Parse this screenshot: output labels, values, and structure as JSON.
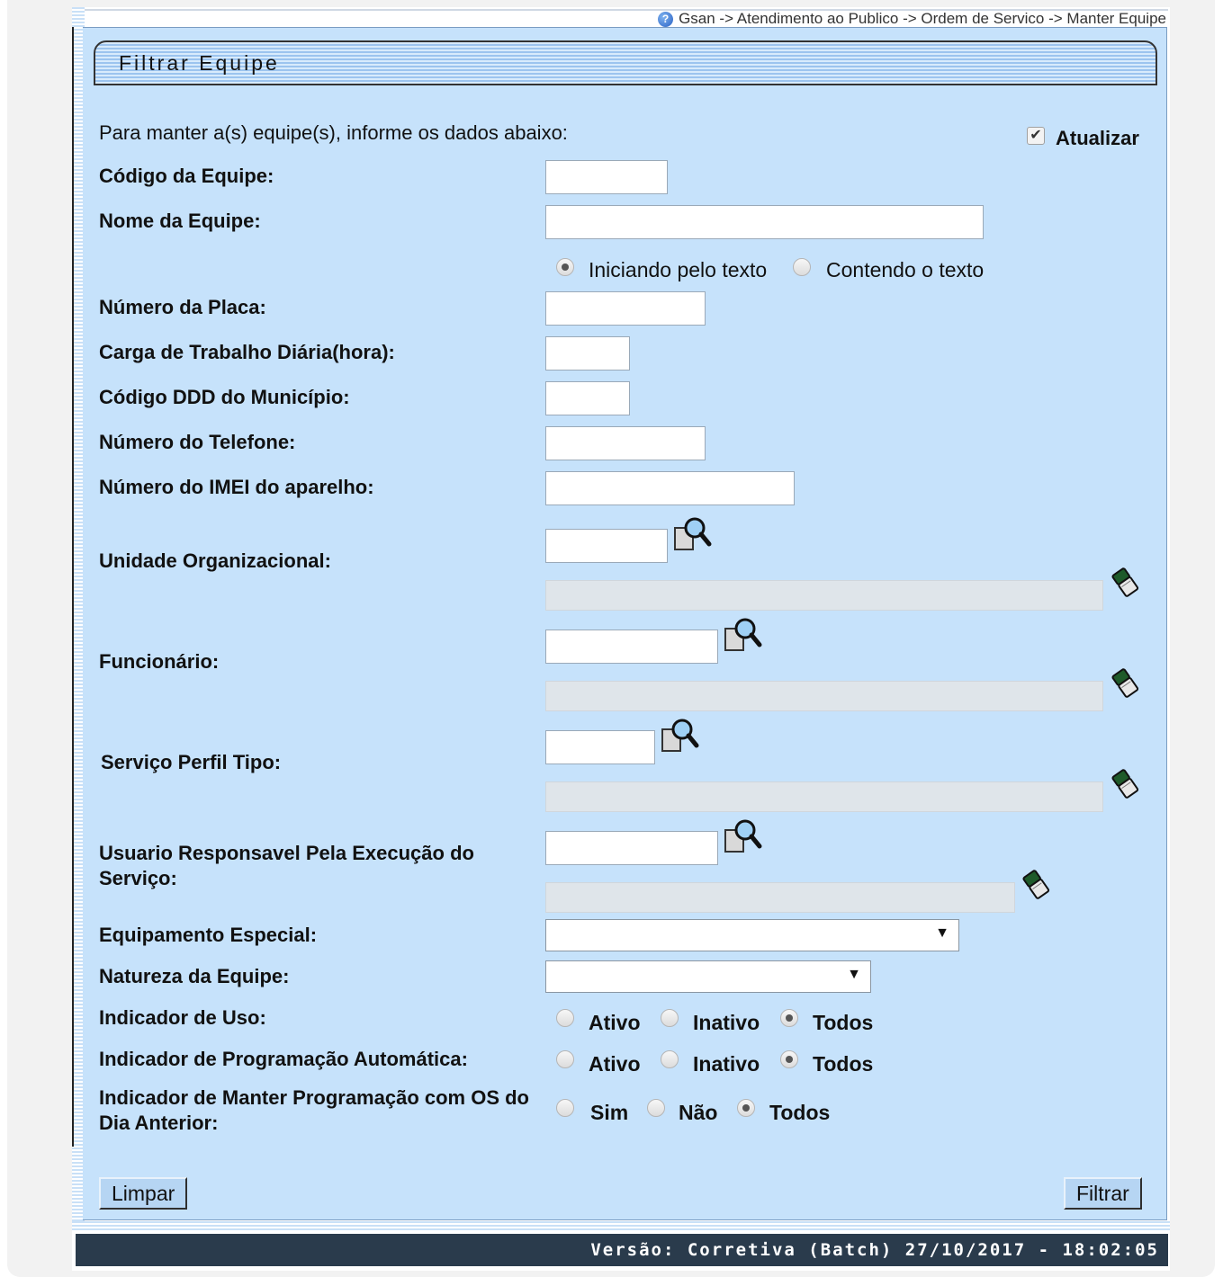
{
  "breadcrumb": "Gsan -> Atendimento ao Publico -> Ordem de Servico -> Manter Equipe",
  "panel_title": "Filtrar Equipe",
  "intro_text": "Para manter a(s) equipe(s), informe os dados abaixo:",
  "atualizar": {
    "label": "Atualizar",
    "checked": true
  },
  "fields": {
    "codigo_equipe": "Código da Equipe:",
    "nome_equipe": "Nome da Equipe:",
    "numero_placa": "Número da Placa:",
    "carga_trabalho": "Carga de Trabalho Diária(hora):",
    "codigo_ddd": "Código DDD do Município:",
    "numero_telefone": "Número do Telefone:",
    "numero_imei": "Número do IMEI do aparelho:",
    "unidade_organizacional": "Unidade Organizacional:",
    "funcionario": "Funcionário:",
    "servico_perfil_tipo": "Serviço Perfil Tipo:",
    "usuario_responsavel": "Usuario Responsavel Pela Execução do Serviço:",
    "equipamento_especial": "Equipamento Especial:",
    "natureza_equipe": "Natureza da Equipe:",
    "indicador_uso": "Indicador de Uso:",
    "indicador_programacao": "Indicador de Programação Automática:",
    "indicador_manter": "Indicador de Manter Programação com OS do Dia Anterior:"
  },
  "nome_match_options": {
    "iniciando": "Iniciando pelo texto",
    "contendo": "Contendo o texto",
    "selected": "iniciando"
  },
  "uso_options": {
    "ativo": "Ativo",
    "inativo": "Inativo",
    "todos": "Todos",
    "selected": "todos"
  },
  "programacao_options": {
    "ativo": "Ativo",
    "inativo": "Inativo",
    "todos": "Todos",
    "selected": "todos"
  },
  "manter_options": {
    "sim": "Sim",
    "nao": "Não",
    "todos": "Todos",
    "selected": "todos"
  },
  "buttons": {
    "limpar": "Limpar",
    "filtrar": "Filtrar"
  },
  "footer": "Versão: Corretiva (Batch) 27/10/2017 - 18:02:05",
  "icons": {
    "help": "help-icon",
    "lookup": "magnifier-lookup-icon",
    "eraser": "eraser-icon"
  }
}
